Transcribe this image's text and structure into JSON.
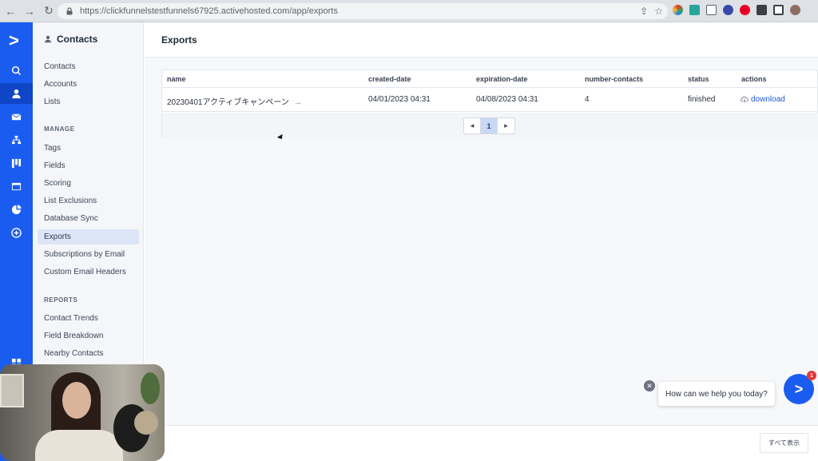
{
  "browser": {
    "url": "https://clickfunnelstestfunnels67925.activehosted.com/app/exports"
  },
  "sidebar": {
    "header": "Contacts",
    "items_top": [
      "Contacts",
      "Accounts",
      "Lists"
    ],
    "manage_label": "MANAGE",
    "manage_items": [
      "Tags",
      "Fields",
      "Scoring",
      "List Exclusions",
      "Database Sync",
      "Exports",
      "Subscriptions by Email",
      "Custom Email Headers"
    ],
    "reports_label": "REPORTS",
    "reports_items": [
      "Contact Trends",
      "Field Breakdown",
      "Nearby Contacts"
    ]
  },
  "page": {
    "title": "Exports"
  },
  "table": {
    "columns": [
      "name",
      "created-date",
      "expiration-date",
      "number-contacts",
      "status",
      "actions"
    ],
    "rows": [
      {
        "name": "20230401アクティブキャンペーン",
        "created": "04/01/2023 04:31",
        "expires": "04/08/2023 04:31",
        "contacts": "4",
        "status": "finished",
        "action": "download"
      }
    ],
    "pagination": {
      "prev": "◂",
      "current": "1",
      "next": "▸"
    }
  },
  "footer": {
    "show_all": "すべて表示"
  },
  "chat": {
    "prompt": "How can we help you today?",
    "badge": "1"
  },
  "colors": {
    "brand": "#1b5cf0",
    "link": "#1f5ad6",
    "active_nav": "#dde6f7"
  }
}
